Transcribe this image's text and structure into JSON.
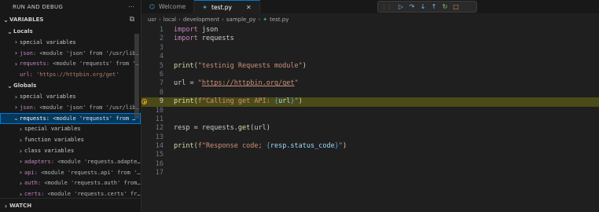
{
  "sidebar": {
    "title": "RUN AND DEBUG",
    "more": "···",
    "variables_header": "VARIABLES",
    "locals_label": "Locals",
    "locals": [
      {
        "chevron": "›",
        "name": "special variables",
        "value": "",
        "plain": true
      },
      {
        "chevron": "›",
        "name": "json:",
        "value": "<module 'json' from '/usr/lib…"
      },
      {
        "chevron": "›",
        "name": "requests:",
        "value": "<module 'requests' from '…"
      },
      {
        "chevron": "",
        "name": "url:",
        "value": "'https://httpbin.org/get'",
        "str": true
      }
    ],
    "globals_label": "Globals",
    "globals": [
      {
        "chevron": "›",
        "name": "special variables",
        "value": "",
        "plain": true
      },
      {
        "chevron": "›",
        "name": "json:",
        "value": "<module 'json' from '/usr/lib…"
      }
    ],
    "selected": {
      "chevron": "⌄",
      "name": "requests:",
      "value": "<module 'requests' from …"
    },
    "children": [
      {
        "chevron": "›",
        "name": "special variables",
        "value": "",
        "plain": true
      },
      {
        "chevron": "›",
        "name": "function variables",
        "value": "",
        "plain": true
      },
      {
        "chevron": "›",
        "name": "class variables",
        "value": "",
        "plain": true
      },
      {
        "chevron": "›",
        "name": "adapters:",
        "value": "<module 'requests.adapte…"
      },
      {
        "chevron": "›",
        "name": "api:",
        "value": "<module 'requests.api' from '…"
      },
      {
        "chevron": "›",
        "name": "auth:",
        "value": "<module 'requests.auth' from…"
      },
      {
        "chevron": "›",
        "name": "certs:",
        "value": "<module 'requests.certs' fr…"
      }
    ],
    "watch_label": "WATCH"
  },
  "tabs": [
    {
      "label": "Welcome",
      "icon": "vscode-icon",
      "active": false
    },
    {
      "label": "test.py",
      "icon": "python-icon",
      "active": true
    }
  ],
  "debug_toolbar": [
    "continue-icon",
    "step-over-icon",
    "step-into-icon",
    "step-out-icon",
    "restart-icon",
    "stop-icon"
  ],
  "breadcrumb": [
    "usr",
    "local",
    "development",
    "sample_py",
    "test.py"
  ],
  "editor": {
    "current_line": 9,
    "lines": [
      {
        "n": "1",
        "code": [
          {
            "t": "import",
            "c": "kw"
          },
          {
            "t": " json",
            "c": ""
          }
        ]
      },
      {
        "n": "2",
        "code": [
          {
            "t": "import",
            "c": "kw"
          },
          {
            "t": " requests",
            "c": ""
          }
        ]
      },
      {
        "n": "3",
        "code": []
      },
      {
        "n": "4",
        "code": []
      },
      {
        "n": "5",
        "code": [
          {
            "t": "print",
            "c": "fn"
          },
          {
            "t": "(",
            "c": ""
          },
          {
            "t": "\"testinig Requests module\"",
            "c": "str"
          },
          {
            "t": ")",
            "c": ""
          }
        ]
      },
      {
        "n": "6",
        "code": []
      },
      {
        "n": "7",
        "code": [
          {
            "t": "url",
            "c": ""
          },
          {
            "t": " = ",
            "c": ""
          },
          {
            "t": "\"",
            "c": "str"
          },
          {
            "t": "https://httpbin.org/get",
            "c": "link"
          },
          {
            "t": "\"",
            "c": "str"
          }
        ]
      },
      {
        "n": "8",
        "code": []
      },
      {
        "n": "9",
        "code": [
          {
            "t": "print",
            "c": "fn"
          },
          {
            "t": "(",
            "c": ""
          },
          {
            "t": "f\"Calling get API: ",
            "c": "str"
          },
          {
            "t": "{",
            "c": "brace"
          },
          {
            "t": "url",
            "c": "varn"
          },
          {
            "t": "}",
            "c": "brace"
          },
          {
            "t": "\"",
            "c": "str"
          },
          {
            "t": ")",
            "c": ""
          }
        ]
      },
      {
        "n": "10",
        "code": []
      },
      {
        "n": "11",
        "code": []
      },
      {
        "n": "12",
        "code": [
          {
            "t": "resp",
            "c": ""
          },
          {
            "t": " = requests.",
            "c": ""
          },
          {
            "t": "get",
            "c": "fn"
          },
          {
            "t": "(url)",
            "c": ""
          }
        ]
      },
      {
        "n": "13",
        "code": []
      },
      {
        "n": "14",
        "code": [
          {
            "t": "print",
            "c": "fn"
          },
          {
            "t": "(",
            "c": ""
          },
          {
            "t": "f\"Response code; ",
            "c": "str"
          },
          {
            "t": "{",
            "c": "brace"
          },
          {
            "t": "resp.status_code",
            "c": "varn"
          },
          {
            "t": "}",
            "c": "brace"
          },
          {
            "t": "\"",
            "c": "str"
          },
          {
            "t": ")",
            "c": ""
          }
        ]
      },
      {
        "n": "15",
        "code": []
      },
      {
        "n": "16",
        "code": []
      },
      {
        "n": "17",
        "code": []
      }
    ]
  }
}
